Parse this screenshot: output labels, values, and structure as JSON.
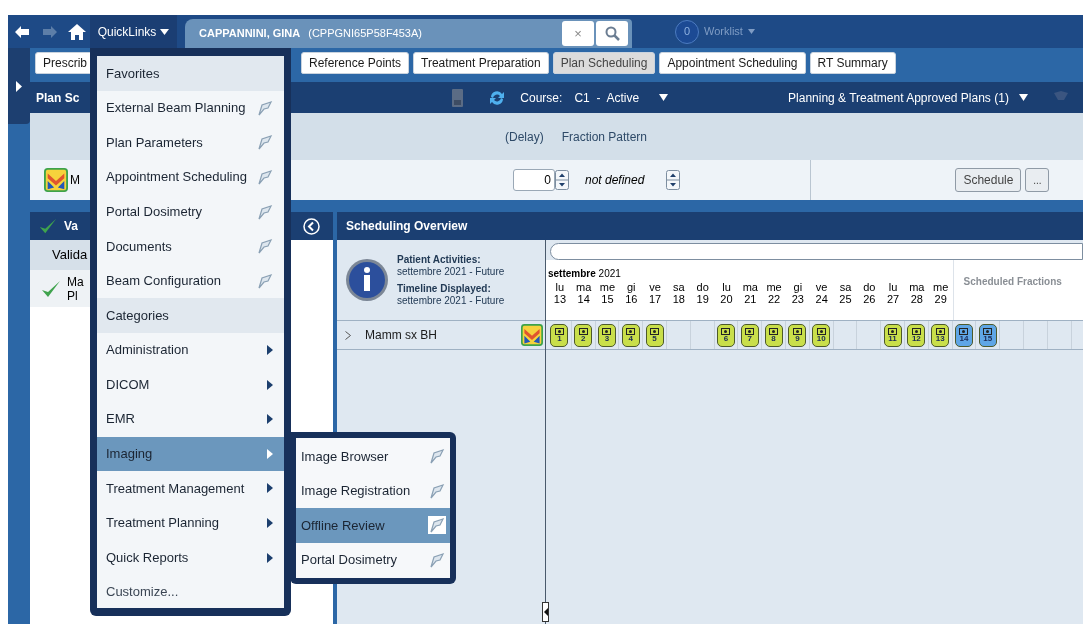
{
  "top_bar": {
    "quicklinks": "QuickLinks",
    "patient_name": "CAPPANNINI, GINA",
    "patient_id": "(CPPGNI65P58F453A)",
    "clear_button": "×",
    "worklist_count": "0",
    "worklist": "Worklist"
  },
  "tabs": [
    {
      "label": "Prescrib",
      "selected": false
    },
    {
      "label": "Reference Points",
      "selected": false
    },
    {
      "label": "Treatment Preparation",
      "selected": false
    },
    {
      "label": "Plan Scheduling",
      "selected": true
    },
    {
      "label": "Appointment Scheduling",
      "selected": false
    },
    {
      "label": "RT Summary",
      "selected": false
    }
  ],
  "plan_panel": {
    "title": "Plan Sc",
    "course_label": "Course:",
    "course_value": "C1  -  Active",
    "plans_filter": "Planning & Treatment Approved Plans (1)",
    "columns": [
      "(Delay)",
      "Fraction Pattern"
    ],
    "row": {
      "name": "M",
      "delay": "0",
      "fraction_pattern": "not defined",
      "schedule_button": "Schedule",
      "more_button": "..."
    }
  },
  "validation_panel": {
    "title": "Va",
    "column": "Valida",
    "row": {
      "line_1": "Ma",
      "line_2": "Pl",
      "valid": true
    }
  },
  "scheduling_overview": {
    "title": "Scheduling Overview",
    "patient_activities_label": "Patient Activities:",
    "patient_activities_value": "settembre 2021 - Future",
    "timeline_label": "Timeline Displayed:",
    "timeline_value": "settembre 2021 - Future",
    "month": "settembre",
    "year": "2021",
    "scheduled_fractions": "Scheduled Fractions",
    "days": [
      {
        "weekday": "lu",
        "day": "13"
      },
      {
        "weekday": "ma",
        "day": "14"
      },
      {
        "weekday": "me",
        "day": "15"
      },
      {
        "weekday": "gi",
        "day": "16"
      },
      {
        "weekday": "ve",
        "day": "17"
      },
      {
        "weekday": "sa",
        "day": "18"
      },
      {
        "weekday": "do",
        "day": "19"
      },
      {
        "weekday": "lu",
        "day": "20"
      },
      {
        "weekday": "ma",
        "day": "21"
      },
      {
        "weekday": "me",
        "day": "22"
      },
      {
        "weekday": "gi",
        "day": "23"
      },
      {
        "weekday": "ve",
        "day": "24"
      },
      {
        "weekday": "sa",
        "day": "25"
      },
      {
        "weekday": "do",
        "day": "26"
      },
      {
        "weekday": "lu",
        "day": "27"
      },
      {
        "weekday": "ma",
        "day": "28"
      },
      {
        "weekday": "me",
        "day": "29"
      }
    ],
    "plan_row": {
      "name": "Mamm sx BH",
      "cells": [
        {
          "kind": "fraction",
          "label": "1",
          "color": "#c9df4a"
        },
        {
          "kind": "fraction",
          "label": "2",
          "color": "#c9df4a"
        },
        {
          "kind": "fraction",
          "label": "3",
          "color": "#c9df4a"
        },
        {
          "kind": "fraction",
          "label": "4",
          "color": "#c9df4a"
        },
        {
          "kind": "fraction",
          "label": "5",
          "color": "#c9df4a"
        },
        {
          "kind": "empty"
        },
        {
          "kind": "empty"
        },
        {
          "kind": "fraction",
          "label": "6",
          "color": "#c9df4a"
        },
        {
          "kind": "fraction",
          "label": "7",
          "color": "#c9df4a"
        },
        {
          "kind": "fraction",
          "label": "8",
          "color": "#c9df4a"
        },
        {
          "kind": "fraction",
          "label": "9",
          "color": "#c9df4a"
        },
        {
          "kind": "fraction",
          "label": "10",
          "color": "#c9df4a"
        },
        {
          "kind": "empty"
        },
        {
          "kind": "empty"
        },
        {
          "kind": "fraction",
          "label": "11",
          "color": "#c9df4a"
        },
        {
          "kind": "fraction",
          "label": "12",
          "color": "#c9df4a"
        },
        {
          "kind": "fraction",
          "label": "13",
          "color": "#c9df4a"
        },
        {
          "kind": "fraction",
          "label": "14",
          "color": "#5fa6e6"
        },
        {
          "kind": "fraction",
          "label": "15",
          "color": "#5fa6e6"
        },
        {
          "kind": "empty"
        },
        {
          "kind": "empty"
        },
        {
          "kind": "empty"
        }
      ]
    }
  },
  "quicklinks_menu": {
    "items": [
      {
        "kind": "header",
        "label": "Favorites",
        "selected": false
      },
      {
        "kind": "favorite",
        "label": "External Beam Planning",
        "selected": false
      },
      {
        "kind": "favorite",
        "label": "Plan Parameters",
        "selected": false
      },
      {
        "kind": "favorite",
        "label": "Appointment Scheduling",
        "selected": false
      },
      {
        "kind": "favorite",
        "label": "Portal Dosimetry",
        "selected": false
      },
      {
        "kind": "favorite",
        "label": "Documents",
        "selected": false
      },
      {
        "kind": "favorite",
        "label": "Beam Configuration",
        "selected": false
      },
      {
        "kind": "header",
        "label": "Categories",
        "selected": false
      },
      {
        "kind": "category",
        "label": "Administration",
        "selected": false
      },
      {
        "kind": "category",
        "label": "DICOM",
        "selected": false
      },
      {
        "kind": "category",
        "label": "EMR",
        "selected": false
      },
      {
        "kind": "category",
        "label": "Imaging",
        "selected": true,
        "children": [
          {
            "label": "Image Browser",
            "selected": false
          },
          {
            "label": "Image Registration",
            "selected": false
          },
          {
            "label": "Offline Review",
            "selected": true
          },
          {
            "label": "Portal Dosimetry",
            "selected": false
          }
        ]
      },
      {
        "kind": "category",
        "label": "Treatment Management",
        "selected": false
      },
      {
        "kind": "category",
        "label": "Treatment Planning",
        "selected": false
      },
      {
        "kind": "category",
        "label": "Quick Reports",
        "selected": false
      },
      {
        "kind": "action",
        "label": "Customize...",
        "selected": false
      }
    ]
  }
}
